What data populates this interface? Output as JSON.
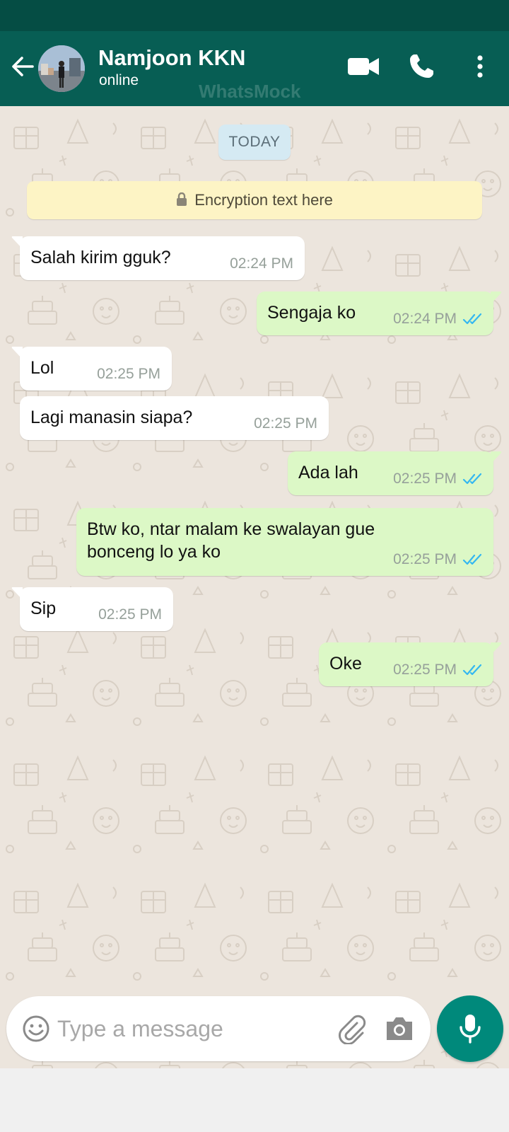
{
  "header": {
    "contact_name": "Namjoon KKN",
    "contact_status": "online",
    "watermark": "WhatsMock",
    "icons": [
      "back-arrow-icon",
      "avatar",
      "video-call-icon",
      "phone-icon",
      "more-options-icon"
    ]
  },
  "chat": {
    "date_label": "TODAY",
    "encryption_notice": "Encryption text here",
    "messages": [
      {
        "direction": "incoming",
        "text": "Salah kirim gguk?",
        "time": "02:24 PM"
      },
      {
        "direction": "outgoing",
        "text": "Sengaja ko",
        "time": "02:24 PM",
        "status": "read"
      },
      {
        "direction": "incoming",
        "text": "Lol",
        "time": "02:25 PM"
      },
      {
        "direction": "incoming",
        "text": "Lagi manasin siapa?",
        "time": "02:25 PM"
      },
      {
        "direction": "outgoing",
        "text": "Ada lah",
        "time": "02:25 PM",
        "status": "read"
      },
      {
        "direction": "outgoing",
        "text_lines": [
          "Btw ko, ntar malam ke swalayan gue",
          "bonceng lo ya ko"
        ],
        "time": "02:25 PM",
        "status": "read"
      },
      {
        "direction": "incoming",
        "text": "Sip",
        "time": "02:25 PM"
      },
      {
        "direction": "outgoing",
        "text": "Oke",
        "time": "02:25 PM",
        "status": "read"
      }
    ]
  },
  "composer": {
    "placeholder": "Type a message",
    "value": "",
    "icons": [
      "emoji-icon",
      "attach-icon",
      "camera-icon",
      "mic-icon"
    ]
  },
  "colors": {
    "header": "#075e54",
    "statusbar": "#054d44",
    "chat_background": "#ece5dd",
    "outgoing_bubble": "#dcf8c6",
    "incoming_bubble": "#ffffff",
    "read_ticks": "#34b7f1",
    "mic_button": "#00897b"
  }
}
